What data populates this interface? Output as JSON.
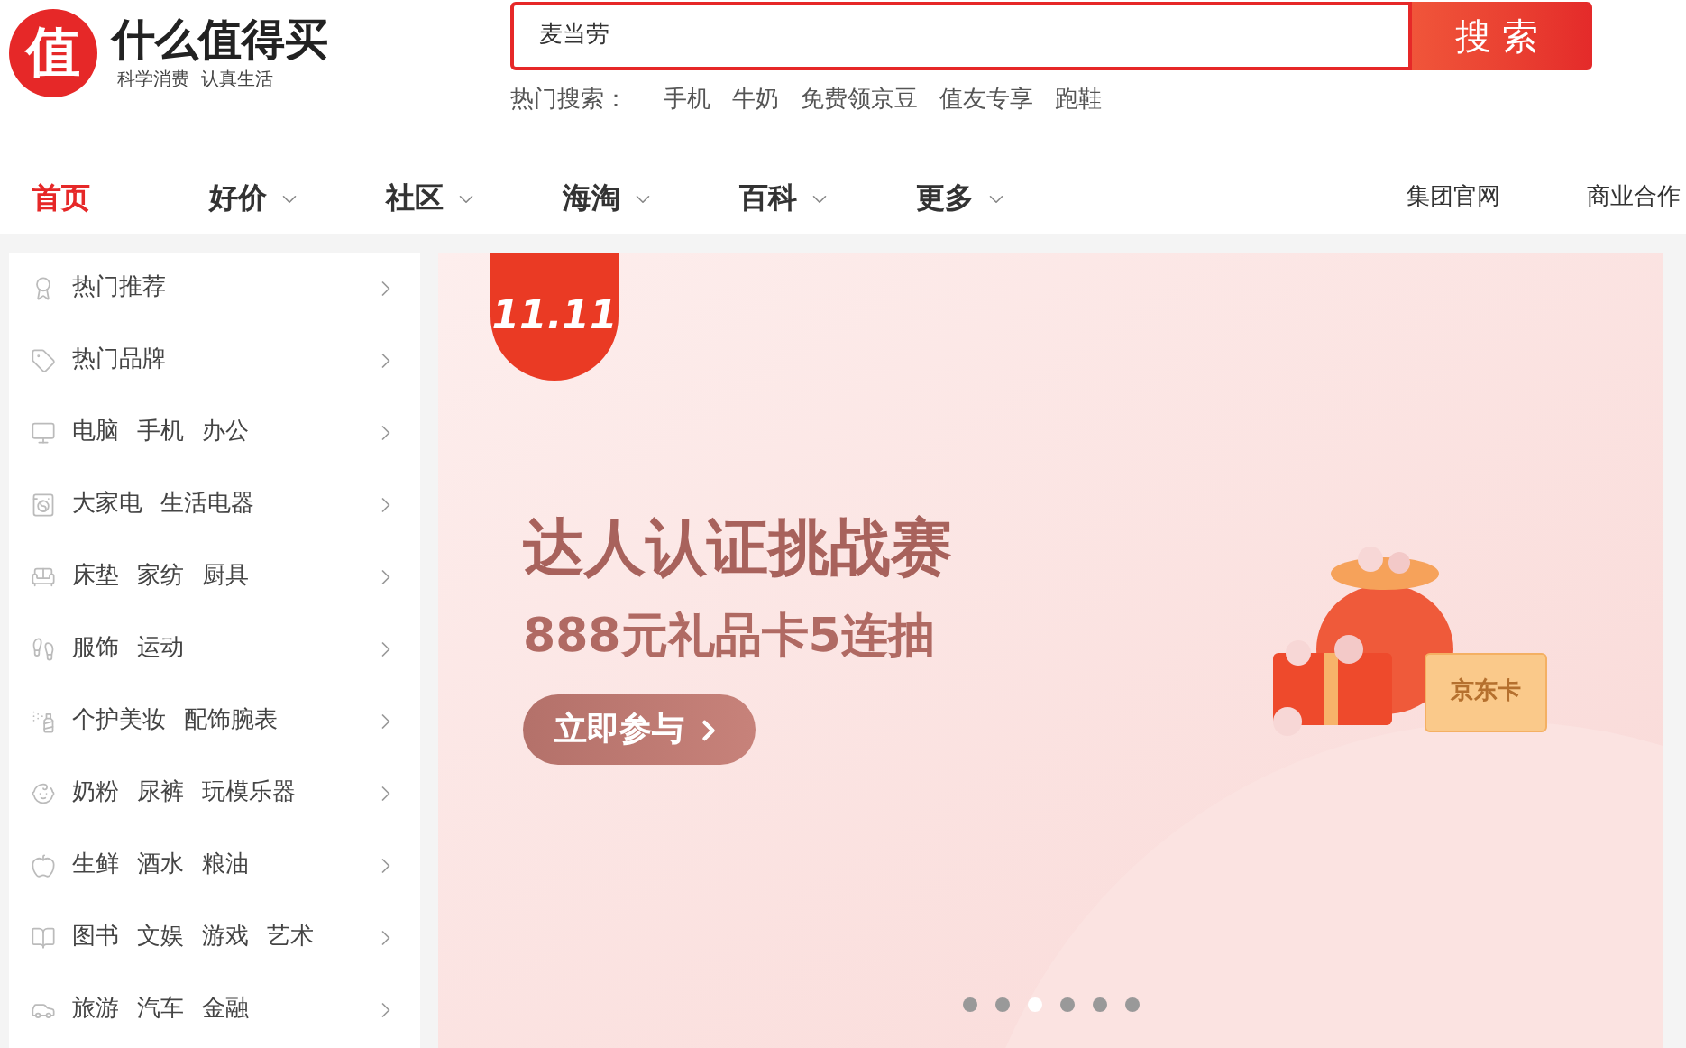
{
  "logo": {
    "mark": "值",
    "name": "什么值得买",
    "slogan": "科学消费  认真生活"
  },
  "search": {
    "value": "麦当劳",
    "button": "搜索"
  },
  "hot_search": {
    "label": "热门搜索：",
    "terms": [
      "手机",
      "牛奶",
      "免费领京豆",
      "值友专享",
      "跑鞋"
    ]
  },
  "nav": [
    {
      "label": "首页",
      "selected": true,
      "has_menu": false
    },
    {
      "label": "好价",
      "selected": false,
      "has_menu": true
    },
    {
      "label": "社区",
      "selected": false,
      "has_menu": true
    },
    {
      "label": "海淘",
      "selected": false,
      "has_menu": true
    },
    {
      "label": "百科",
      "selected": false,
      "has_menu": true
    },
    {
      "label": "更多",
      "selected": false,
      "has_menu": true
    }
  ],
  "nav_links": [
    "集团官网",
    "商业合作"
  ],
  "sidebar": {
    "items": [
      {
        "links": [
          "热门推荐"
        ]
      },
      {
        "links": [
          "热门品牌"
        ]
      },
      {
        "links": [
          "电脑",
          "手机",
          "办公"
        ]
      },
      {
        "links": [
          "大家电",
          "生活电器"
        ]
      },
      {
        "links": [
          "床垫",
          "家纺",
          "厨具"
        ]
      },
      {
        "links": [
          "服饰",
          "运动"
        ]
      },
      {
        "links": [
          "个护美妆",
          "配饰腕表"
        ]
      },
      {
        "links": [
          "奶粉",
          "尿裤",
          "玩模乐器"
        ]
      },
      {
        "links": [
          "生鲜",
          "酒水",
          "粮油"
        ]
      },
      {
        "links": [
          "图书",
          "文娱",
          "游戏",
          "艺术"
        ]
      },
      {
        "links": [
          "旅游",
          "汽车",
          "金融"
        ]
      }
    ]
  },
  "banner": {
    "badge": "11.11",
    "title": "达人认证挑战赛",
    "subtitle": "888元礼品卡5连抽",
    "button": "立即参与",
    "card_label": "京东卡",
    "dots": [
      {
        "selected": false
      },
      {
        "selected": false
      },
      {
        "selected": true
      },
      {
        "selected": false
      },
      {
        "selected": false
      },
      {
        "selected": false
      }
    ]
  }
}
